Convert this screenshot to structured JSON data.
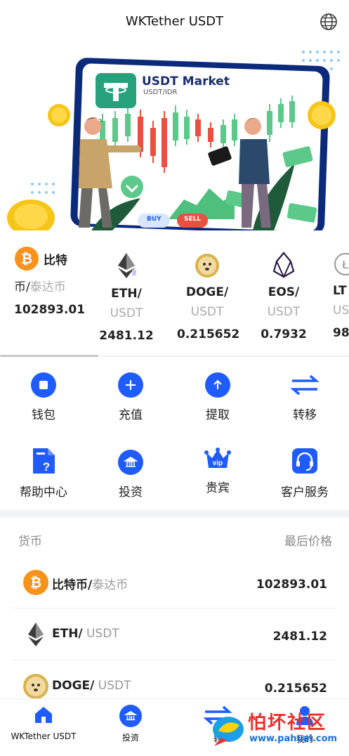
{
  "header": {
    "title": "WKTether USDT"
  },
  "banner": {
    "card_title": "USDT Market",
    "card_subtitle": "USDT/IDR",
    "buy_label": "BUY",
    "sell_label": "SELL"
  },
  "ticker": [
    {
      "name": "比特",
      "sub_left": "币/",
      "sub_right": "泰达币",
      "price": "102893.01",
      "icon": "bitcoin-icon"
    },
    {
      "name": "ETH/",
      "sub": "USDT",
      "price": "2481.12",
      "icon": "ethereum-icon"
    },
    {
      "name": "DOGE/",
      "sub": "USDT",
      "price": "0.215652",
      "icon": "dogecoin-icon"
    },
    {
      "name": "EOS/",
      "sub": "USDT",
      "price": "0.7932",
      "icon": "eos-icon"
    },
    {
      "name": "LT",
      "sub": "US",
      "price": "98.",
      "icon": "litecoin-icon"
    }
  ],
  "actions": [
    {
      "label": "钱包",
      "icon": "wallet-icon"
    },
    {
      "label": "充值",
      "icon": "plus-icon"
    },
    {
      "label": "提取",
      "icon": "arrow-up-icon"
    },
    {
      "label": "转移",
      "icon": "transfer-icon"
    },
    {
      "label": "帮助中心",
      "icon": "help-document-icon"
    },
    {
      "label": "投资",
      "icon": "bank-icon"
    },
    {
      "label": "贵宾",
      "icon": "vip-crown-icon"
    },
    {
      "label": "客户服务",
      "icon": "headset-icon"
    }
  ],
  "market": {
    "col_currency": "货币",
    "col_price": "最后价格",
    "rows": [
      {
        "base": "比特币/",
        "quote": "泰达币",
        "price": "102893.01",
        "icon": "bitcoin-icon"
      },
      {
        "base": "ETH/",
        "quote": " USDT",
        "price": "2481.12",
        "icon": "ethereum-icon"
      },
      {
        "base": "DOGE/",
        "quote": " USDT",
        "price": "0.215652",
        "icon": "dogecoin-icon"
      }
    ]
  },
  "bottom_nav": [
    {
      "label": "WKTether USDT",
      "icon": "home-icon"
    },
    {
      "label": "投资",
      "icon": "bank-icon"
    },
    {
      "label": "转",
      "icon": "transfer-icon"
    },
    {
      "label": "我的",
      "icon": "user-icon"
    }
  ],
  "watermark": {
    "text": "怕坏社区",
    "url_text": "www.pahuai.com"
  },
  "colors": {
    "accent": "#1f5bff",
    "bitcoin": "#f7931a",
    "tether": "#26a17b"
  }
}
